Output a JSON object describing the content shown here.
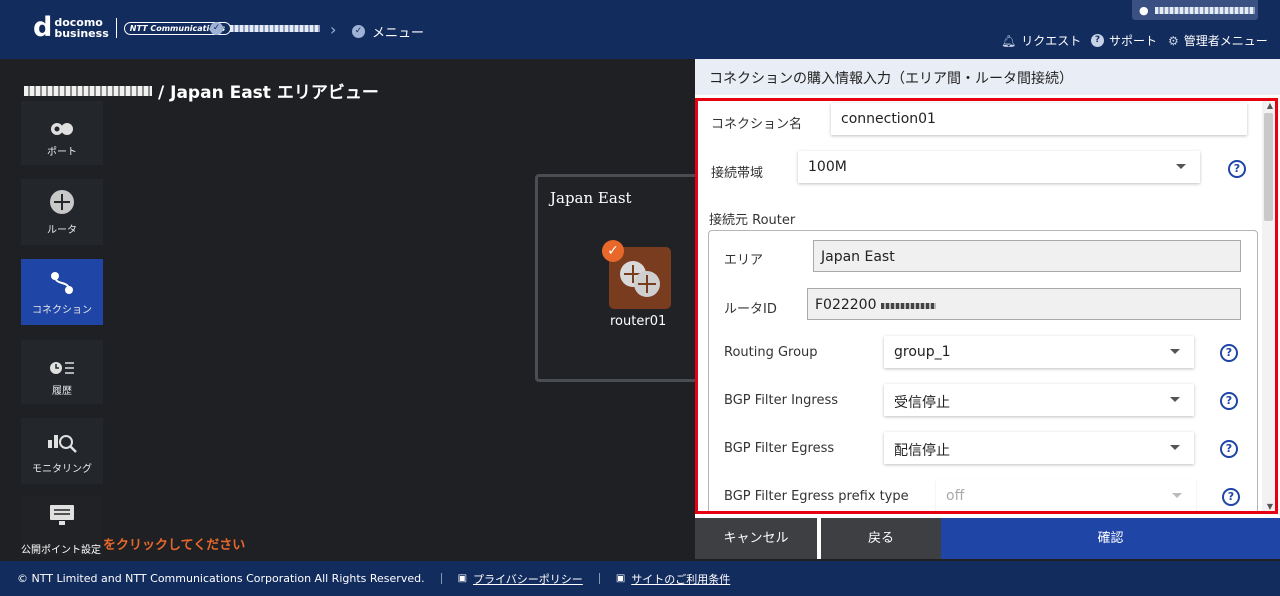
{
  "header": {
    "brand_line1": "docomo",
    "brand_line2": "business",
    "brand_ntt": "NTT Communications",
    "crumb_menu": "メニュー",
    "nav": {
      "request": "リクエスト",
      "support": "サポート",
      "admin_menu": "管理者メニュー"
    }
  },
  "area": {
    "title_suffix": "/ Japan East エリアビュー",
    "sidebar": [
      {
        "label": "ポート"
      },
      {
        "label": "ルータ"
      },
      {
        "label": "コネクション"
      },
      {
        "label": "履歴"
      },
      {
        "label": "モニタリング"
      },
      {
        "label": "公開ポイント設定"
      }
    ],
    "region_name": "Japan East",
    "router_name": "router01",
    "notice": "をクリックしてください"
  },
  "panel": {
    "title": "コネクションの購入情報入力（エリア間・ルータ間接続）",
    "connection_name": {
      "label": "コネクション名",
      "value": "connection01"
    },
    "bandwidth": {
      "label": "接続帯域",
      "value": "100M"
    },
    "source_router": {
      "label": "接続元 Router",
      "area": {
        "label": "エリア",
        "value": "Japan East"
      },
      "router_id": {
        "label": "ルータID",
        "value": "F022200"
      },
      "routing_group": {
        "label": "Routing Group",
        "value": "group_1"
      },
      "bgp_ingress": {
        "label": "BGP Filter Ingress",
        "value": "受信停止"
      },
      "bgp_egress": {
        "label": "BGP Filter Egress",
        "value": "配信停止"
      },
      "bgp_egress_prefix": {
        "label": "BGP Filter Egress prefix type",
        "value": "off"
      }
    },
    "help_glyph": "?"
  },
  "buttons": {
    "cancel": "キャンセル",
    "back": "戻る",
    "confirm": "確認"
  },
  "footer": {
    "copyright": "© NTT Limited and NTT Communications Corporation All Rights Reserved.",
    "privacy": "プライバシーポリシー",
    "terms": "サイトのご利用条件"
  },
  "colors": {
    "header_bg": "#132c5e",
    "accent_blue": "#1f46a6",
    "highlight_red": "#e60012",
    "orange": "#e8672a"
  }
}
